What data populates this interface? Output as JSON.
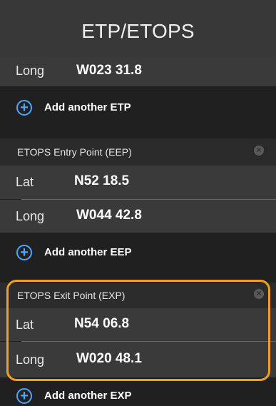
{
  "header": {
    "title": "ETP/ETOPS"
  },
  "etp": {
    "long_label": "Long",
    "long_value": "W023 31.8",
    "add_label": "Add another ETP"
  },
  "eep": {
    "title": "ETOPS Entry Point (EEP)",
    "lat_label": "Lat",
    "lat_value": "N52 18.5",
    "long_label": "Long",
    "long_value": "W044 42.8",
    "add_label": "Add another EEP"
  },
  "exp": {
    "title": "ETOPS Exit Point (EXP)",
    "lat_label": "Lat",
    "lat_value": "N54 06.8",
    "long_label": "Long",
    "long_value": "W020 48.1",
    "add_label": "Add another EXP"
  },
  "icons": {
    "add": "plus-circle-icon",
    "clear": "clear-circle-icon"
  },
  "colors": {
    "accent": "#4da6ff",
    "highlight": "#f0a020",
    "row_background": "#3a3a3a",
    "panel_background": "#202020"
  }
}
